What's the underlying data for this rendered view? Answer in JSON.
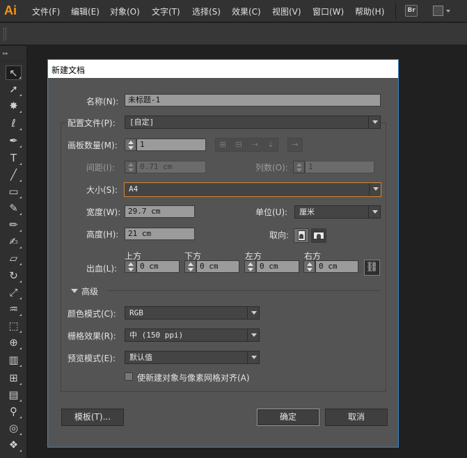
{
  "app": {
    "logo": "Ai",
    "menu": [
      "文件(F)",
      "编辑(E)",
      "对象(O)",
      "文字(T)",
      "选择(S)",
      "效果(C)",
      "视图(V)",
      "窗口(W)",
      "帮助(H)"
    ],
    "bridge_label": "Br"
  },
  "toolbar": {
    "tools": [
      "selection-tool-icon",
      "direct-selection-tool-icon",
      "magic-wand-icon",
      "lasso-icon",
      "pen-tool-icon",
      "type-tool-icon",
      "line-tool-icon",
      "rectangle-tool-icon",
      "paintbrush-icon",
      "pencil-icon",
      "blob-brush-icon",
      "eraser-icon",
      "rotate-tool-icon",
      "scale-tool-icon",
      "warp-tool-icon",
      "free-transform-icon",
      "shape-builder-icon",
      "graph-tool-icon",
      "mesh-tool-icon",
      "gradient-tool-icon",
      "eyedropper-icon",
      "blend-tool-icon",
      "symbol-sprayer-icon"
    ]
  },
  "dialog": {
    "title": "新建文档",
    "name_label": "名称(N):",
    "name_value": "未标题-1",
    "profile_label": "配置文件(P):",
    "profile_value": "[自定]",
    "artboards_label": "画板数量(M):",
    "artboards_value": "1",
    "spacing_label": "间距(I):",
    "spacing_value": "0.71 cm",
    "columns_label": "列数(O):",
    "columns_value": "1",
    "size_label": "大小(S):",
    "size_value": "A4",
    "width_label": "宽度(W):",
    "width_value": "29.7 cm",
    "units_label": "单位(U):",
    "units_value": "厘米",
    "height_label": "高度(H):",
    "height_value": "21 cm",
    "orientation_label": "取向:",
    "bleed_label": "出血(L):",
    "bleed": {
      "top_label": "上方",
      "top_value": "0 cm",
      "bottom_label": "下方",
      "bottom_value": "0 cm",
      "left_label": "左方",
      "left_value": "0 cm",
      "right_label": "右方",
      "right_value": "0 cm"
    },
    "advanced_label": "高级",
    "color_mode_label": "颜色模式(C):",
    "color_mode_value": "RGB",
    "raster_label": "栅格效果(R):",
    "raster_value": "中 (150 ppi)",
    "preview_label": "预览模式(E):",
    "preview_value": "默认值",
    "align_pixel_label": "使新建对象与像素网格对齐(A)",
    "align_pixel_checked": false,
    "templates_button": "模板(T)...",
    "ok_button": "确定",
    "cancel_button": "取消"
  },
  "colors": {
    "accent_focus": "#d4882e",
    "dialog_border": "#3c88c8",
    "logo": "#f7931e"
  }
}
